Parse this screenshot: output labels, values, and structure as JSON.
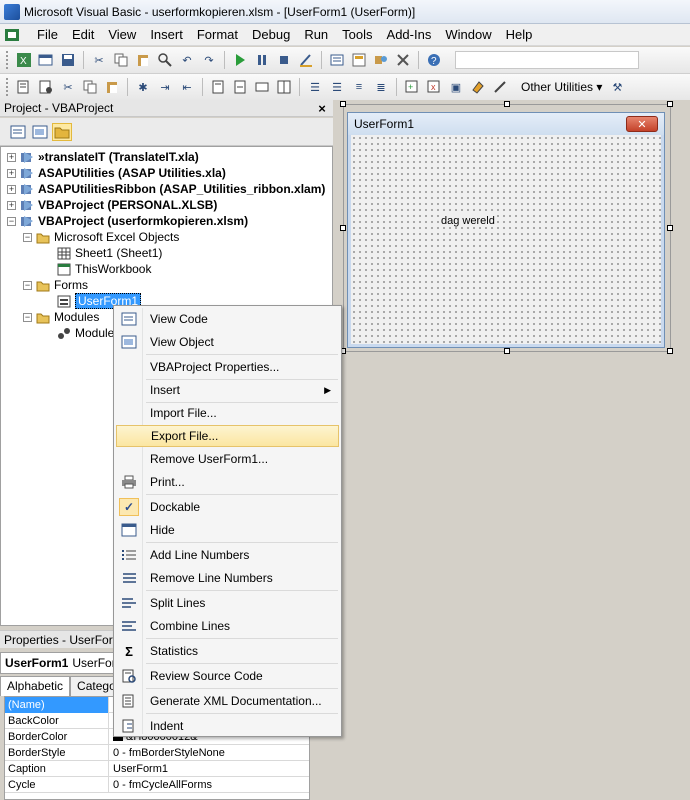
{
  "window": {
    "title": "Microsoft Visual Basic - userformkopieren.xlsm - [UserForm1 (UserForm)]"
  },
  "menu": [
    "File",
    "Edit",
    "View",
    "Insert",
    "Format",
    "Debug",
    "Run",
    "Tools",
    "Add-Ins",
    "Window",
    "Help"
  ],
  "toolbar2": {
    "other_utilities": "Other Utilities"
  },
  "project": {
    "title": "Project - VBAProject",
    "close": "×",
    "nodes": [
      "»translateIT (TranslateIT.xla)",
      "ASAPUtilities (ASAP Utilities.xla)",
      "ASAPUtilitiesRibbon (ASAP_Utilities_ribbon.xlam)",
      "VBAProject (PERSONAL.XLSB)",
      "VBAProject (userformkopieren.xlsm)",
      "Microsoft Excel Objects",
      "Sheet1 (Sheet1)",
      "ThisWorkbook",
      "Forms",
      "UserForm1",
      "Modules",
      "Module"
    ]
  },
  "properties": {
    "title": "Properties - UserForm",
    "object_name": "UserForm1",
    "object_type": "UserForm",
    "tabs": [
      "Alphabetic",
      "Categoriz"
    ],
    "rows": [
      {
        "name": "(Name)",
        "value": ""
      },
      {
        "name": "BackColor",
        "value": ""
      },
      {
        "name": "BorderColor",
        "value": "&H80000012&"
      },
      {
        "name": "BorderStyle",
        "value": "0 - fmBorderStyleNone"
      },
      {
        "name": "Caption",
        "value": "UserForm1"
      },
      {
        "name": "Cycle",
        "value": "0 - fmCycleAllForms"
      }
    ]
  },
  "userform": {
    "caption": "UserForm1",
    "label": "dag wereld",
    "close": "✕"
  },
  "context_menu": {
    "items": [
      {
        "label": "View Code",
        "icon": "view-code-icon"
      },
      {
        "label": "View Object",
        "icon": "view-object-icon"
      },
      {
        "label": "VBAProject Properties...",
        "icon": ""
      },
      {
        "label": "Insert",
        "icon": "",
        "submenu": "▶"
      },
      {
        "label": "Import File...",
        "icon": ""
      },
      {
        "label": "Export File...",
        "icon": ""
      },
      {
        "label": "Remove UserForm1...",
        "icon": ""
      },
      {
        "label": "Print...",
        "icon": "printer-icon"
      },
      {
        "label": "Dockable",
        "icon": "checkmark-icon"
      },
      {
        "label": "Hide",
        "icon": "hide-icon"
      },
      {
        "label": "Add Line Numbers",
        "icon": "add-line-numbers-icon"
      },
      {
        "label": "Remove Line Numbers",
        "icon": "remove-line-numbers-icon"
      },
      {
        "label": "Split Lines",
        "icon": "split-lines-icon"
      },
      {
        "label": "Combine Lines",
        "icon": "combine-lines-icon"
      },
      {
        "label": "Statistics",
        "icon": "sigma-icon"
      },
      {
        "label": "Review Source Code",
        "icon": "review-icon"
      },
      {
        "label": "Generate XML Documentation...",
        "icon": "xml-icon"
      },
      {
        "label": "Indent",
        "icon": "indent-icon"
      }
    ],
    "icons": {
      "check": "✓",
      "sigma": "Σ"
    }
  },
  "colors": {
    "highlight": "#3399ff",
    "menu_highlight": "#fbe6a1"
  }
}
